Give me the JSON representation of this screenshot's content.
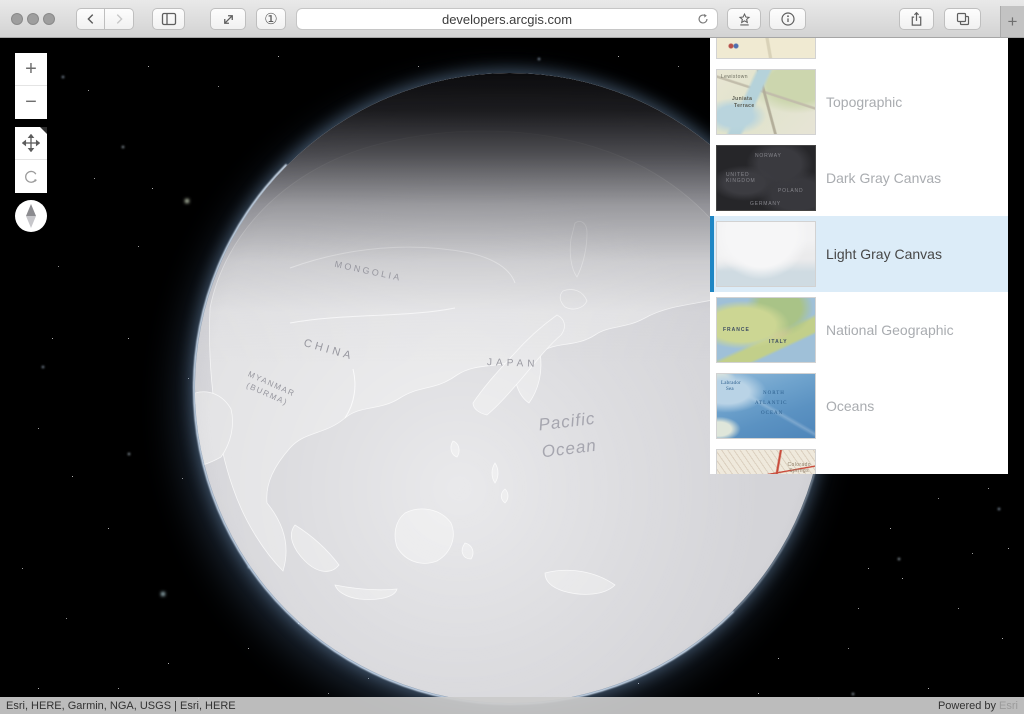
{
  "browser": {
    "url": "developers.arcgis.com",
    "extension_glyph": "①",
    "new_tab_glyph": "+"
  },
  "map": {
    "zoom_in": "+",
    "zoom_out": "−",
    "labels": {
      "mongolia": "MONGOLIA",
      "china": "CHINA",
      "japan": "JAPAN",
      "myanmar1": "MYANMAR",
      "myanmar2": "(BURMA)",
      "ocean1": "Pacific",
      "ocean2": "Ocean"
    }
  },
  "gallery": {
    "accent_color": "#1e86c4",
    "selected_bg": "#dcecf8",
    "items": [
      {
        "name": "streets",
        "label": "",
        "selected": false,
        "thumb_labels": []
      },
      {
        "name": "topographic",
        "label": "Topographic",
        "selected": false,
        "thumb_labels": [
          "Lewistown",
          "Juniata",
          "Terrace"
        ]
      },
      {
        "name": "dark-gray-canvas",
        "label": "Dark Gray Canvas",
        "selected": false,
        "thumb_labels": [
          "NORWAY",
          "UNITED",
          "KINGDOM",
          "POLAND",
          "GERMANY"
        ]
      },
      {
        "name": "light-gray-canvas",
        "label": "Light Gray Canvas",
        "selected": true,
        "thumb_labels": []
      },
      {
        "name": "national-geographic",
        "label": "National Geographic",
        "selected": false,
        "thumb_labels": [
          "FRANCE",
          "ITALY"
        ]
      },
      {
        "name": "oceans",
        "label": "Oceans",
        "selected": false,
        "thumb_labels": [
          "Labrador",
          "Sea",
          "NORTH",
          "ATLANTIC",
          "OCEAN"
        ]
      },
      {
        "name": "terrain",
        "label": "",
        "selected": false,
        "thumb_labels": [
          "Colorado",
          "Springs"
        ]
      }
    ]
  },
  "attribution": {
    "sources": "Esri, HERE, Garmin, NGA, USGS | Esri, HERE",
    "powered_by": "Powered by",
    "brand": "Esri"
  }
}
